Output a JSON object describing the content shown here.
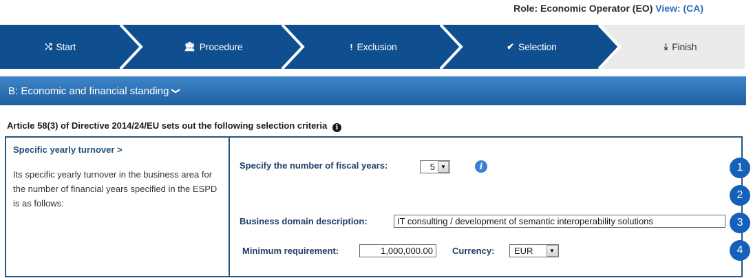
{
  "header": {
    "role_label": "Role: Economic Operator (EO)",
    "view_label": "View: (CA)"
  },
  "wizard": {
    "steps": [
      {
        "label": "Start",
        "icon": "shuffle-icon",
        "glyph": "⤭"
      },
      {
        "label": "Procedure",
        "icon": "institution-icon",
        "glyph": "🏛"
      },
      {
        "label": "Exclusion",
        "icon": "exclamation-icon",
        "glyph": "!"
      },
      {
        "label": "Selection",
        "icon": "check-circle-icon",
        "glyph": "✔"
      },
      {
        "label": "Finish",
        "icon": "download-icon",
        "glyph": "⤓"
      }
    ],
    "active_color": "#104f8f",
    "inactive_color": "#ebebeb"
  },
  "section": {
    "title": "B: Economic and financial standing",
    "chevron": "❯"
  },
  "article_text": "Article 58(3) of Directive 2014/24/EU sets out the following selection criteria",
  "criterion": {
    "title": "Specific yearly turnover >",
    "description": "Its specific yearly turnover in the business area for the number  of financial years specified in the ESPD is as follows:"
  },
  "form": {
    "fiscal_years_label": "Specify the number of fiscal years:",
    "fiscal_years_value": "5",
    "business_domain_label": "Business domain description:",
    "business_domain_value": "IT consulting / development of semantic interoperability solutions",
    "min_requirement_label": "Minimum requirement:",
    "min_requirement_value": "1,000,000.00",
    "currency_label": "Currency:",
    "currency_value": "EUR"
  },
  "markers": [
    "1",
    "2",
    "3",
    "4"
  ],
  "info_glyph": "i"
}
